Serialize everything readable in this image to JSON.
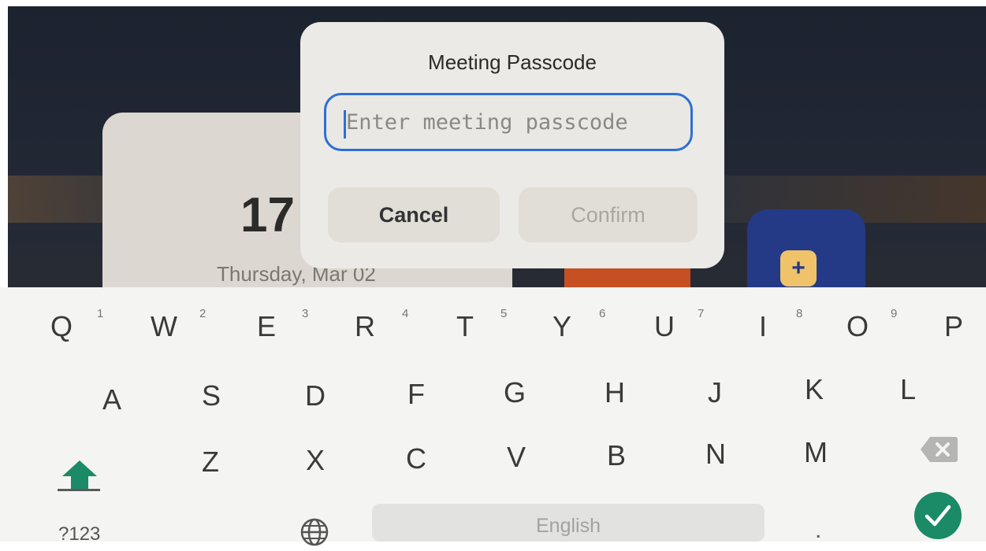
{
  "background": {
    "date_day": "17",
    "date_sub": "Thursday, Mar 02",
    "plus_label": "+"
  },
  "dialog": {
    "title": "Meeting Passcode",
    "passcode_placeholder": "Enter meeting passcode",
    "passcode_value": "",
    "cancel_label": "Cancel",
    "confirm_label": "Confirm"
  },
  "keyboard": {
    "row1": [
      {
        "letter": "Q",
        "hint": "1"
      },
      {
        "letter": "W",
        "hint": "2"
      },
      {
        "letter": "E",
        "hint": "3"
      },
      {
        "letter": "R",
        "hint": "4"
      },
      {
        "letter": "T",
        "hint": "5"
      },
      {
        "letter": "Y",
        "hint": "6"
      },
      {
        "letter": "U",
        "hint": "7"
      },
      {
        "letter": "I",
        "hint": "8"
      },
      {
        "letter": "O",
        "hint": "9"
      },
      {
        "letter": "P",
        "hint": ""
      }
    ],
    "row2": [
      "A",
      "S",
      "D",
      "F",
      "G",
      "H",
      "J",
      "K",
      "L"
    ],
    "row3": [
      "Z",
      "X",
      "C",
      "V",
      "B",
      "N",
      "M"
    ],
    "symbols_label": "?123",
    "space_label": "English",
    "period_label": ".",
    "accent_color": "#1b8a66",
    "focus_color": "#2e6fd4"
  }
}
